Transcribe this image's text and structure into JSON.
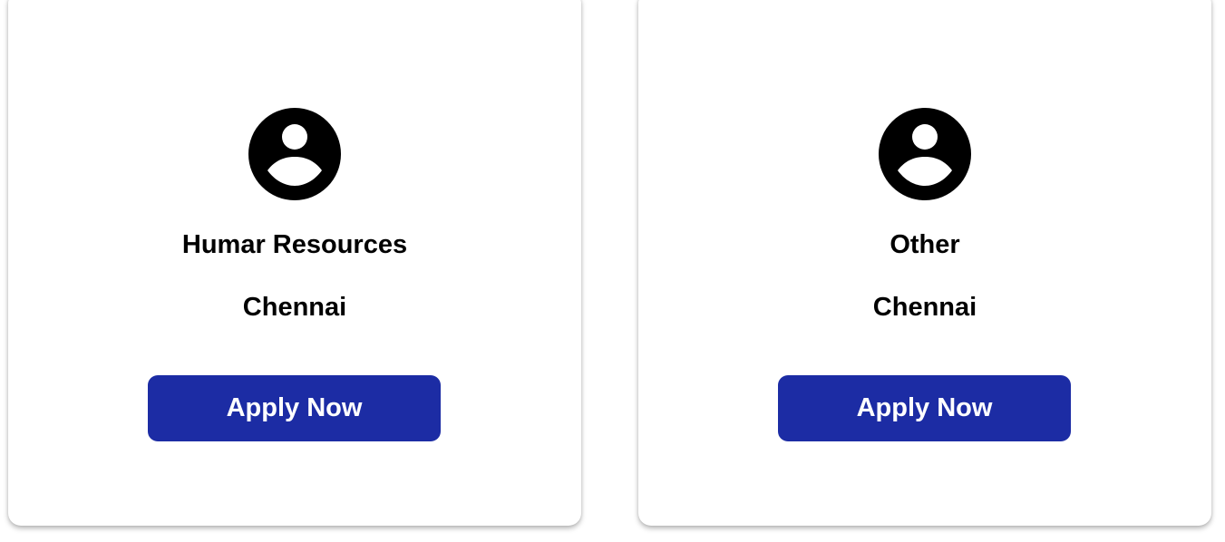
{
  "jobs": [
    {
      "icon": "user-circle-icon",
      "title": "Humar Resources",
      "location": "Chennai",
      "apply_label": "Apply Now"
    },
    {
      "icon": "user-circle-icon",
      "title": "Other",
      "location": "Chennai",
      "apply_label": "Apply Now"
    }
  ],
  "colors": {
    "button": "#1c2ca4",
    "button_text": "#ffffff",
    "text": "#000000",
    "card": "#ffffff"
  }
}
